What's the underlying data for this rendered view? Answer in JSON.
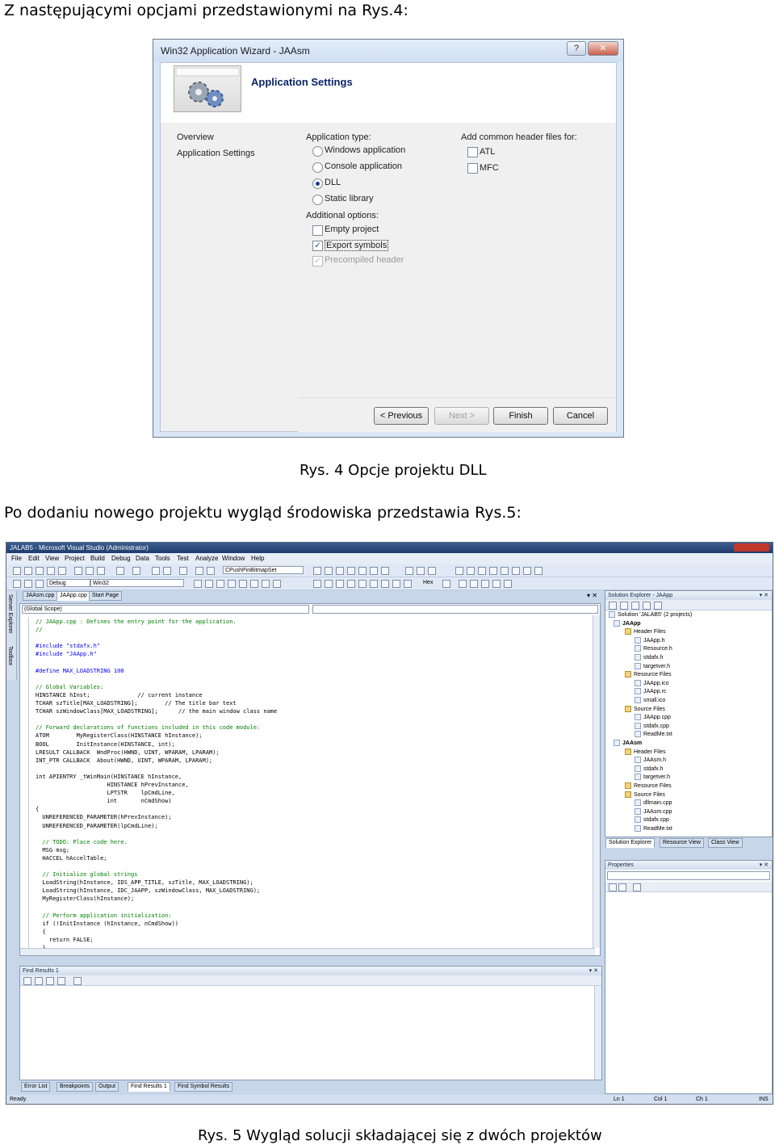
{
  "doc": {
    "intro_text": "Z następującymi opcjami przedstawionymi na Rys.4:",
    "caption4": "Rys. 4 Opcje projektu DLL",
    "para2": "Po dodaniu nowego projektu wygląd środowiska przedstawia Rys.5:",
    "caption5": "Rys. 5 Wygląd solucji składającej się z dwóch projektów"
  },
  "wizard": {
    "title": "Win32 Application Wizard - JAAsm",
    "help_glyph": "?",
    "close_glyph": "✕",
    "header_title": "Application Settings",
    "nav": [
      "Overview",
      "Application Settings"
    ],
    "app_type_label": "Application type:",
    "app_types": [
      {
        "label": "Windows application",
        "selected": false
      },
      {
        "label": "Console application",
        "selected": false
      },
      {
        "label": "DLL",
        "selected": true
      },
      {
        "label": "Static library",
        "selected": false
      }
    ],
    "additional_label": "Additional options:",
    "additional": [
      {
        "label": "Empty project",
        "checked": false,
        "disabled": false
      },
      {
        "label": "Export symbols",
        "checked": true,
        "disabled": false
      },
      {
        "label": "Precompiled header",
        "checked": true,
        "disabled": true
      }
    ],
    "headers_label": "Add common header files for:",
    "headers": [
      {
        "label": "ATL",
        "checked": false
      },
      {
        "label": "MFC",
        "checked": false
      }
    ],
    "buttons": {
      "previous": "< Previous",
      "next": "Next >",
      "finish": "Finish",
      "cancel": "Cancel"
    }
  },
  "vs": {
    "title": "JALAB5 - Microsoft Visual Studio (Administrator)",
    "menu": [
      "File",
      "Edit",
      "View",
      "Project",
      "Build",
      "Debug",
      "Data",
      "Tools",
      "Test",
      "Analyze",
      "Window",
      "Help"
    ],
    "config": "Debug",
    "platform": "Win32",
    "find_combo": "CPushPinBitmapSet",
    "hex_label": "Hex",
    "tabs": [
      "JAAsm.cpp",
      "JAApp.cpp",
      "Start Page"
    ],
    "scope": "(Global Scope)",
    "side_tabs": [
      "Server Explorer",
      "Toolbox"
    ],
    "solution_explorer": {
      "title": "Solution Explorer - JAApp",
      "items": [
        {
          "label": "Solution 'JALAB5' (2 projects)",
          "type": "solution"
        },
        {
          "label": "JAApp",
          "type": "project"
        },
        {
          "label": "Header Files",
          "type": "folder"
        },
        {
          "label": "JAApp.h",
          "type": "file"
        },
        {
          "label": "Resource.h",
          "type": "file"
        },
        {
          "label": "stdafx.h",
          "type": "file"
        },
        {
          "label": "targetver.h",
          "type": "file"
        },
        {
          "label": "Resource Files",
          "type": "folder"
        },
        {
          "label": "JAApp.ico",
          "type": "file"
        },
        {
          "label": "JAApp.rc",
          "type": "file"
        },
        {
          "label": "small.ico",
          "type": "file"
        },
        {
          "label": "Source Files",
          "type": "folder"
        },
        {
          "label": "JAApp.cpp",
          "type": "file"
        },
        {
          "label": "stdafx.cpp",
          "type": "file"
        },
        {
          "label": "ReadMe.txt",
          "type": "file"
        },
        {
          "label": "JAAsm",
          "type": "project"
        },
        {
          "label": "Header Files",
          "type": "folder"
        },
        {
          "label": "JAAsm.h",
          "type": "file"
        },
        {
          "label": "stdafx.h",
          "type": "file"
        },
        {
          "label": "targetver.h",
          "type": "file"
        },
        {
          "label": "Resource Files",
          "type": "folder"
        },
        {
          "label": "Source Files",
          "type": "folder"
        },
        {
          "label": "dllmain.cpp",
          "type": "file"
        },
        {
          "label": "JAAsm.cpp",
          "type": "file"
        },
        {
          "label": "stdafx.cpp",
          "type": "file"
        },
        {
          "label": "ReadMe.txt",
          "type": "file"
        }
      ]
    },
    "explorer_tabs": [
      "Solution Explorer",
      "Resource View",
      "Class View"
    ],
    "properties_title": "Properties",
    "find_results_title": "Find Results 1",
    "bottom_tabs": [
      "Error List",
      "Breakpoints",
      "Output",
      "Find Results 1",
      "Find Symbol Results"
    ],
    "status": {
      "ready": "Ready",
      "ln": "Ln 1",
      "col": "Col 1",
      "ch": "Ch 1",
      "ins": "INS"
    },
    "code": [
      {
        "t": "// JAApp.cpp : Defines the entry point for the application.",
        "c": "cm"
      },
      {
        "t": "//",
        "c": "cm"
      },
      {
        "t": "",
        "c": ""
      },
      {
        "t": "#include \"stdafx.h\"",
        "c": "pp"
      },
      {
        "t": "#include \"JAApp.h\"",
        "c": "pp"
      },
      {
        "t": "",
        "c": ""
      },
      {
        "t": "#define MAX_LOADSTRING 100",
        "c": "pp"
      },
      {
        "t": "",
        "c": ""
      },
      {
        "t": "// Global Variables:",
        "c": "cm"
      },
      {
        "t": "HINSTANCE hInst;              // current instance",
        "c": ""
      },
      {
        "t": "TCHAR szTitle[MAX_LOADSTRING];        // The title bar text",
        "c": ""
      },
      {
        "t": "TCHAR szWindowClass[MAX_LOADSTRING];      // the main window class name",
        "c": ""
      },
      {
        "t": "",
        "c": ""
      },
      {
        "t": "// Forward declarations of functions included in this code module:",
        "c": "cm"
      },
      {
        "t": "ATOM        MyRegisterClass(HINSTANCE hInstance);",
        "c": ""
      },
      {
        "t": "BOOL        InitInstance(HINSTANCE, int);",
        "c": ""
      },
      {
        "t": "LRESULT CALLBACK  WndProc(HWND, UINT, WPARAM, LPARAM);",
        "c": ""
      },
      {
        "t": "INT_PTR CALLBACK  About(HWND, UINT, WPARAM, LPARAM);",
        "c": ""
      },
      {
        "t": "",
        "c": ""
      },
      {
        "t": "int APIENTRY _tWinMain(HINSTANCE hInstance,",
        "c": ""
      },
      {
        "t": "                     HINSTANCE hPrevInstance,",
        "c": ""
      },
      {
        "t": "                     LPTSTR    lpCmdLine,",
        "c": ""
      },
      {
        "t": "                     int       nCmdShow)",
        "c": ""
      },
      {
        "t": "{",
        "c": ""
      },
      {
        "t": "  UNREFERENCED_PARAMETER(hPrevInstance);",
        "c": ""
      },
      {
        "t": "  UNREFERENCED_PARAMETER(lpCmdLine);",
        "c": ""
      },
      {
        "t": "",
        "c": ""
      },
      {
        "t": "  // TODO: Place code here.",
        "c": "cm"
      },
      {
        "t": "  MSG msg;",
        "c": ""
      },
      {
        "t": "  HACCEL hAccelTable;",
        "c": ""
      },
      {
        "t": "",
        "c": ""
      },
      {
        "t": "  // Initialize global strings",
        "c": "cm"
      },
      {
        "t": "  LoadString(hInstance, IDS_APP_TITLE, szTitle, MAX_LOADSTRING);",
        "c": ""
      },
      {
        "t": "  LoadString(hInstance, IDC_JAAPP, szWindowClass, MAX_LOADSTRING);",
        "c": ""
      },
      {
        "t": "  MyRegisterClass(hInstance);",
        "c": ""
      },
      {
        "t": "",
        "c": ""
      },
      {
        "t": "  // Perform application initialization:",
        "c": "cm"
      },
      {
        "t": "  if (!InitInstance (hInstance, nCmdShow))",
        "c": ""
      },
      {
        "t": "  {",
        "c": ""
      },
      {
        "t": "    return FALSE;",
        "c": ""
      },
      {
        "t": "  }",
        "c": ""
      }
    ]
  }
}
